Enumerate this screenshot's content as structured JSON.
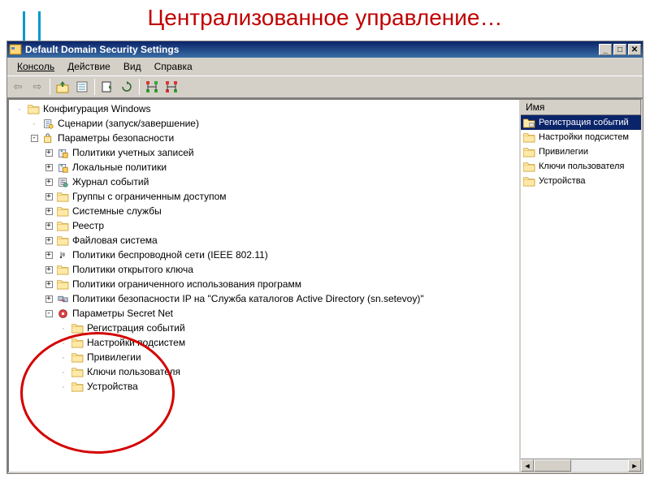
{
  "slide_title": "Централизованное управление…",
  "window_title": "Default Domain Security Settings",
  "menu": {
    "console": "Консоль",
    "action": "Действие",
    "view": "Вид",
    "help": "Справка"
  },
  "list_header": "Имя",
  "list_items": [
    {
      "label": "Регистрация событий",
      "selected": true,
      "icon": "folder-special"
    },
    {
      "label": "Настройки подсистем",
      "selected": false,
      "icon": "folder"
    },
    {
      "label": "Привилегии",
      "selected": false,
      "icon": "folder"
    },
    {
      "label": "Ключи пользователя",
      "selected": false,
      "icon": "folder"
    },
    {
      "label": "Устройства",
      "selected": false,
      "icon": "folder"
    }
  ],
  "tree": [
    {
      "depth": 0,
      "exp": "",
      "icon": "folder-open",
      "label": "Конфигурация Windows"
    },
    {
      "depth": 1,
      "exp": "",
      "icon": "script",
      "label": "Сценарии (запуск/завершение)"
    },
    {
      "depth": 1,
      "exp": "-",
      "icon": "security",
      "label": "Параметры безопасности"
    },
    {
      "depth": 2,
      "exp": "+",
      "icon": "policy",
      "label": "Политики учетных записей"
    },
    {
      "depth": 2,
      "exp": "+",
      "icon": "policy",
      "label": "Локальные политики"
    },
    {
      "depth": 2,
      "exp": "+",
      "icon": "eventlog",
      "label": "Журнал событий"
    },
    {
      "depth": 2,
      "exp": "+",
      "icon": "folder",
      "label": "Группы с ограниченным доступом"
    },
    {
      "depth": 2,
      "exp": "+",
      "icon": "folder",
      "label": "Системные службы"
    },
    {
      "depth": 2,
      "exp": "+",
      "icon": "folder",
      "label": "Реестр"
    },
    {
      "depth": 2,
      "exp": "+",
      "icon": "folder",
      "label": "Файловая система"
    },
    {
      "depth": 2,
      "exp": "+",
      "icon": "wireless",
      "label": "Политики беспроводной сети (IEEE 802.11)"
    },
    {
      "depth": 2,
      "exp": "+",
      "icon": "folder",
      "label": "Политики открытого ключа"
    },
    {
      "depth": 2,
      "exp": "+",
      "icon": "folder",
      "label": "Политики ограниченного использования программ"
    },
    {
      "depth": 2,
      "exp": "+",
      "icon": "ipsec",
      "label": "Политики безопасности IP на \"Служба каталогов Active Directory (sn.setevoy)\""
    },
    {
      "depth": 2,
      "exp": "-",
      "icon": "secretnet",
      "label": "Параметры Secret Net"
    },
    {
      "depth": 3,
      "exp": "",
      "icon": "folder",
      "label": "Регистрация событий"
    },
    {
      "depth": 3,
      "exp": "",
      "icon": "folder",
      "label": "Настройки подсистем"
    },
    {
      "depth": 3,
      "exp": "",
      "icon": "folder",
      "label": "Привилегии"
    },
    {
      "depth": 3,
      "exp": "",
      "icon": "folder",
      "label": "Ключи пользователя"
    },
    {
      "depth": 3,
      "exp": "",
      "icon": "folder",
      "label": "Устройства"
    }
  ]
}
